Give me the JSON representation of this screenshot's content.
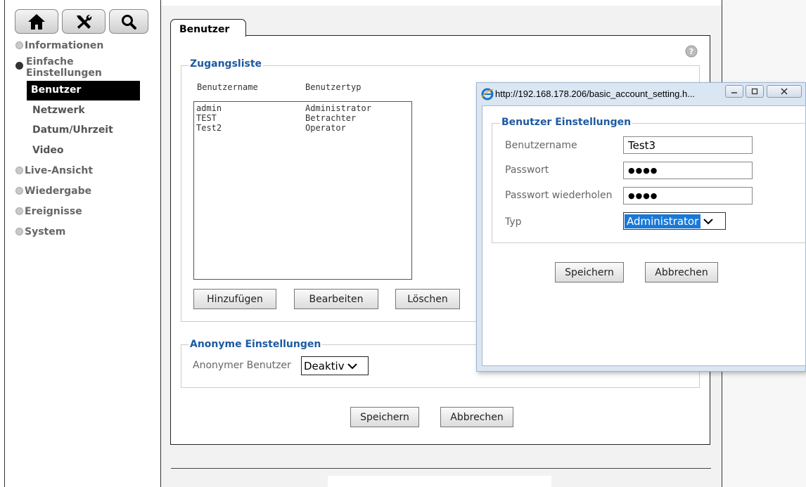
{
  "nav": {
    "items": [
      {
        "label": "Informationen"
      },
      {
        "label": "Einfache Einstellungen"
      },
      {
        "label": "Live-Ansicht"
      },
      {
        "label": "Wiedergabe"
      },
      {
        "label": "Ereignisse"
      },
      {
        "label": "System"
      }
    ],
    "sub_items": [
      {
        "label": "Benutzer"
      },
      {
        "label": "Netzwerk"
      },
      {
        "label": "Datum/Uhrzeit"
      },
      {
        "label": "Video"
      }
    ],
    "einfache_line1": "Einfache",
    "einfache_line2": "Einstellungen"
  },
  "main": {
    "tab_label": "Benutzer",
    "zugangsliste": {
      "legend": "Zugangsliste",
      "col_username": "Benutzername",
      "col_type": "Benutzertyp",
      "rows": [
        {
          "name": "admin",
          "type": "Administrator"
        },
        {
          "name": "TEST",
          "type": "Betrachter"
        },
        {
          "name": "Test2",
          "type": "Operator"
        }
      ],
      "add_label": "Hinzufügen",
      "edit_label": "Bearbeiten",
      "delete_label": "Löschen"
    },
    "anonym": {
      "legend": "Anonyme Einstellungen",
      "label": "Anonymer Benutzer",
      "value": "Deaktiv"
    },
    "save_label": "Speichern",
    "cancel_label": "Abbrechen"
  },
  "dialog": {
    "title": "http://192.168.178.206/basic_account_setting.h...",
    "legend": "Benutzer Einstellungen",
    "username_label": "Benutzername",
    "username_value": "Test3",
    "password_label": "Passwort",
    "password_value": "●●●●",
    "password_repeat_label": "Passwort wiederholen",
    "password_repeat_value": "●●●●",
    "type_label": "Typ",
    "type_value": "Administrator",
    "save_label": "Speichern",
    "cancel_label": "Abbrechen"
  },
  "colors": {
    "legend": "#1e5aa0",
    "select_highlight": "#1a79d8"
  }
}
